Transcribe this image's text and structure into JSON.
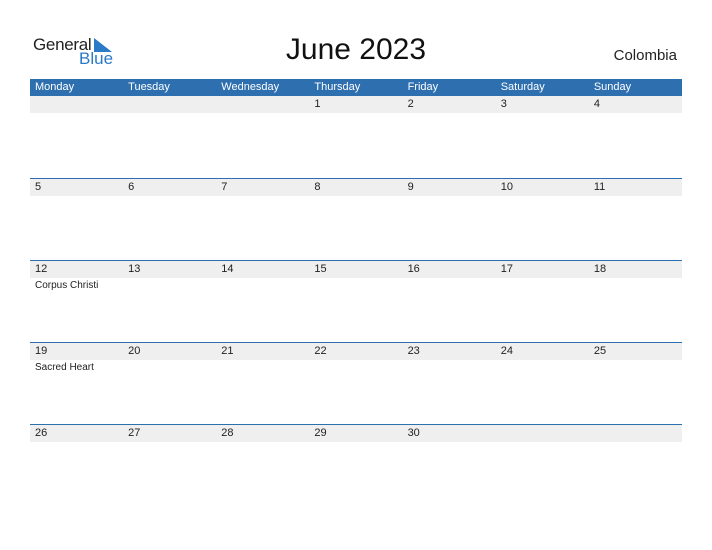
{
  "logo": {
    "general": "General",
    "blue": "Blue"
  },
  "title": "June 2023",
  "country": "Colombia",
  "weekdays": [
    "Monday",
    "Tuesday",
    "Wednesday",
    "Thursday",
    "Friday",
    "Saturday",
    "Sunday"
  ],
  "weeks": [
    {
      "days": [
        "",
        "",
        "",
        "1",
        "2",
        "3",
        "4"
      ],
      "events": [
        "",
        "",
        "",
        "",
        "",
        "",
        ""
      ]
    },
    {
      "days": [
        "5",
        "6",
        "7",
        "8",
        "9",
        "10",
        "11"
      ],
      "events": [
        "",
        "",
        "",
        "",
        "",
        "",
        ""
      ]
    },
    {
      "days": [
        "12",
        "13",
        "14",
        "15",
        "16",
        "17",
        "18"
      ],
      "events": [
        "Corpus Christi",
        "",
        "",
        "",
        "",
        "",
        ""
      ]
    },
    {
      "days": [
        "19",
        "20",
        "21",
        "22",
        "23",
        "24",
        "25"
      ],
      "events": [
        "Sacred Heart",
        "",
        "",
        "",
        "",
        "",
        ""
      ]
    },
    {
      "days": [
        "26",
        "27",
        "28",
        "29",
        "30",
        "",
        ""
      ],
      "events": [
        "",
        "",
        "",
        "",
        "",
        "",
        ""
      ]
    }
  ],
  "colors": {
    "header": "#2e6fb0",
    "strip": "#efefef",
    "brand": "#2a7ac8"
  }
}
